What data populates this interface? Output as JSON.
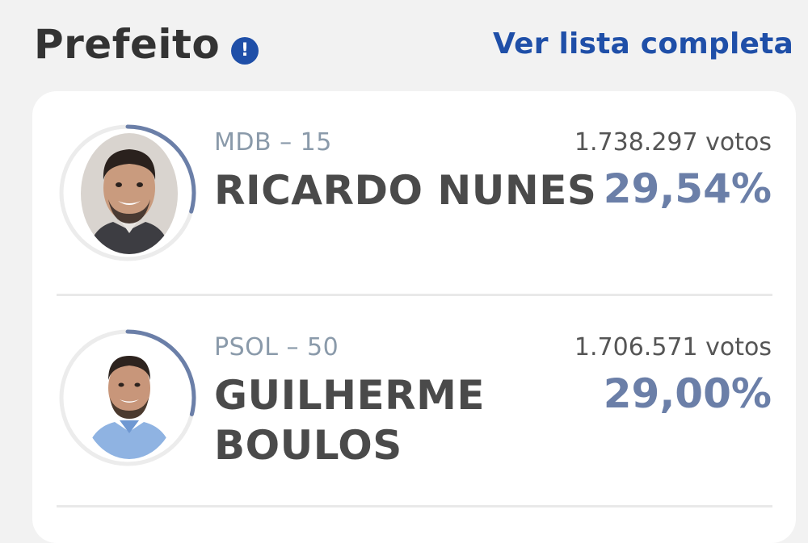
{
  "header": {
    "title": "Prefeito",
    "info_icon": "info-icon",
    "info_symbol": "!",
    "see_all_label": "Ver lista completa"
  },
  "colors": {
    "accent": "#1f4fa8",
    "percent": "#6b7fa8",
    "ring_progress": "#6b7fa8",
    "ring_track": "#ececec"
  },
  "candidates": [
    {
      "party": "MDB – 15",
      "name": "RICARDO NUNES",
      "votes": "1.738.297 votos",
      "percent": "29,54%",
      "share": 0.2954
    },
    {
      "party": "PSOL – 50",
      "name": "GUILHERME BOULOS",
      "votes": "1.706.571 votos",
      "percent": "29,00%",
      "share": 0.29
    }
  ]
}
